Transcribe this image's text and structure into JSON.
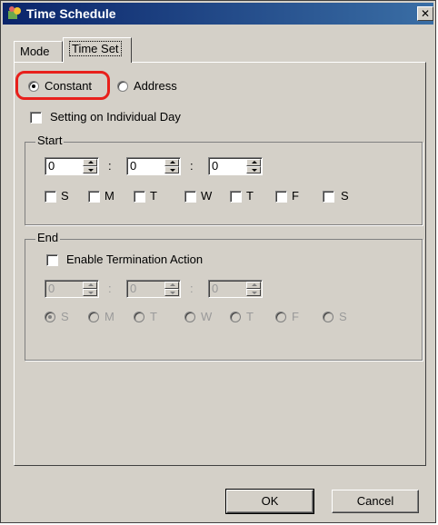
{
  "window": {
    "title": "Time Schedule",
    "close_glyph": "✕",
    "icon": "app-icon"
  },
  "tabs": [
    {
      "label": "Mode"
    },
    {
      "label": "Time Set"
    }
  ],
  "mode_options": {
    "constant_label": "Constant",
    "address_label": "Address",
    "selected": "Constant"
  },
  "individual_day": {
    "label": "Setting on Individual Day",
    "checked": false
  },
  "start": {
    "title": "Start",
    "hour": "0",
    "minute": "0",
    "second": "0",
    "separator": ":",
    "days": [
      "S",
      "M",
      "T",
      "W",
      "T",
      "F",
      "S"
    ]
  },
  "end": {
    "title": "End",
    "enable_label": "Enable Termination Action",
    "hour": "0",
    "minute": "0",
    "second": "0",
    "separator": ":",
    "days": [
      "S",
      "M",
      "T",
      "W",
      "T",
      "F",
      "S"
    ]
  },
  "buttons": {
    "ok": "OK",
    "cancel": "Cancel"
  },
  "colors": {
    "highlight": "#e8201c",
    "title_bar": "#0a246a",
    "face": "#d4d0c8"
  }
}
